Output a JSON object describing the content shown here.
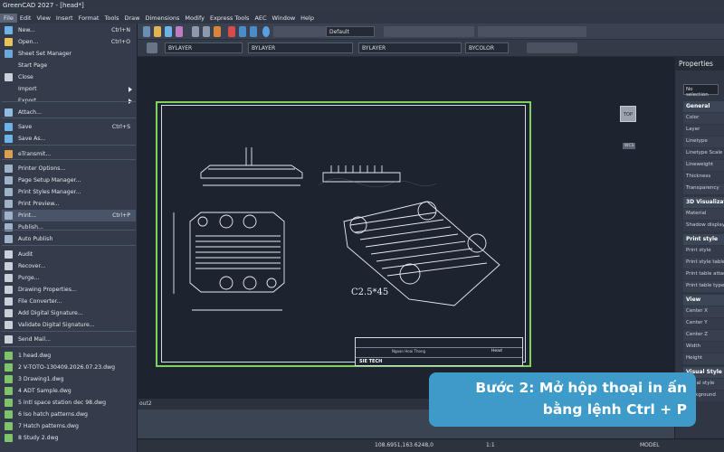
{
  "app": {
    "title": "GreenCAD 2027 - [head*]"
  },
  "menubar": [
    "File",
    "Edit",
    "View",
    "Insert",
    "Format",
    "Tools",
    "Draw",
    "Dimensions",
    "Modify",
    "Express Tools",
    "AEC",
    "Window",
    "Help"
  ],
  "toolbar": {
    "style_dropdown": "Default",
    "layer_dropdown": "BYLAYER",
    "linetype_dropdown": "BYLAYER",
    "lineweight_dropdown": "BYLAYER",
    "color_dropdown": "BYCOLOR"
  },
  "file_menu": [
    {
      "label": "New...",
      "shortcut": "Ctrl+N",
      "icon": "new-icon",
      "color": "#6db3e8"
    },
    {
      "label": "Open...",
      "shortcut": "Ctrl+O",
      "icon": "open-icon",
      "color": "#e9c35a"
    },
    {
      "label": "Sheet Set Manager",
      "shortcut": "",
      "icon": "sheet-set-icon",
      "color": "#6aa9d8"
    },
    {
      "label": "Start Page",
      "shortcut": "",
      "icon": "",
      "color": ""
    },
    {
      "label": "Close",
      "shortcut": "",
      "icon": "close-doc-icon",
      "color": "#c9d0da"
    },
    {
      "label": "Import",
      "shortcut": "",
      "icon": "",
      "color": "",
      "submenu": true
    },
    {
      "label": "Export",
      "shortcut": "",
      "icon": "",
      "color": "",
      "submenu": true
    },
    {
      "label": "Attach...",
      "shortcut": "",
      "icon": "attach-icon",
      "color": "#8fbce0"
    },
    {
      "label": "Save",
      "shortcut": "Ctrl+S",
      "icon": "save-icon",
      "color": "#6db3e8"
    },
    {
      "label": "Save As...",
      "shortcut": "",
      "icon": "save-as-icon",
      "color": "#6db3e8"
    },
    {
      "label": "eTransmit...",
      "shortcut": "",
      "icon": "etransmit-icon",
      "color": "#d9a04f"
    },
    {
      "label": "Printer Options...",
      "shortcut": "",
      "icon": "printer-options-icon",
      "color": "#9fb3c8"
    },
    {
      "label": "Page Setup Manager...",
      "shortcut": "",
      "icon": "page-setup-icon",
      "color": "#9fb3c8"
    },
    {
      "label": "Print Styles Manager...",
      "shortcut": "",
      "icon": "print-styles-icon",
      "color": "#9fb3c8"
    },
    {
      "label": "Print Preview...",
      "shortcut": "",
      "icon": "print-preview-icon",
      "color": "#9fb3c8"
    },
    {
      "label": "Print...",
      "shortcut": "Ctrl+P",
      "icon": "print-icon",
      "color": "#9fb3c8"
    },
    {
      "label": "Publish...",
      "shortcut": "",
      "icon": "publish-icon",
      "color": "#9fb3c8"
    },
    {
      "label": "Auto Publish",
      "shortcut": "",
      "icon": "auto-publish-icon",
      "color": "#9fb3c8"
    },
    {
      "label": "Audit",
      "shortcut": "",
      "icon": "audit-icon",
      "color": "#c9d0da"
    },
    {
      "label": "Recover...",
      "shortcut": "",
      "icon": "recover-icon",
      "color": "#c9d0da"
    },
    {
      "label": "Purge...",
      "shortcut": "",
      "icon": "purge-icon",
      "color": "#c9d0da"
    },
    {
      "label": "Drawing Properties...",
      "shortcut": "",
      "icon": "drawing-properties-icon",
      "color": "#c9d0da"
    },
    {
      "label": "File Converter...",
      "shortcut": "",
      "icon": "file-converter-icon",
      "color": "#c9d0da"
    },
    {
      "label": "Add Digital Signature...",
      "shortcut": "",
      "icon": "signature-icon",
      "color": "#c9d0da"
    },
    {
      "label": "Validate Digital Signature...",
      "shortcut": "",
      "icon": "validate-signature-icon",
      "color": "#c9d0da"
    },
    {
      "label": "Send Mail...",
      "shortcut": "",
      "icon": "mail-icon",
      "color": "#c9d0da"
    },
    {
      "label": "1 head.dwg",
      "shortcut": "",
      "icon": "dwg-file-icon",
      "color": "#7fc46a"
    },
    {
      "label": "2 V-TOTO-130409.2026.07.23.dwg",
      "shortcut": "",
      "icon": "dwg-file-icon",
      "color": "#7fc46a"
    },
    {
      "label": "3 Drawing1.dwg",
      "shortcut": "",
      "icon": "dwg-file-icon",
      "color": "#7fc46a"
    },
    {
      "label": "4 ADT Sample.dwg",
      "shortcut": "",
      "icon": "dwg-file-icon",
      "color": "#7fc46a"
    },
    {
      "label": "5 Intl space station dec 98.dwg",
      "shortcut": "",
      "icon": "dwg-file-icon",
      "color": "#7fc46a"
    },
    {
      "label": "6 Iso hatch patterns.dwg",
      "shortcut": "",
      "icon": "dwg-file-icon",
      "color": "#7fc46a"
    },
    {
      "label": "7 Hatch patterns.dwg",
      "shortcut": "",
      "icon": "dwg-file-icon",
      "color": "#7fc46a"
    },
    {
      "label": "8 Study 2.dwg",
      "shortcut": "",
      "icon": "dwg-file-icon",
      "color": "#7fc46a"
    }
  ],
  "properties": {
    "title": "Properties",
    "selection": "No selection",
    "items": [
      {
        "label": "General",
        "cat": true
      },
      {
        "label": "Color"
      },
      {
        "label": "Layer"
      },
      {
        "label": "Linetype"
      },
      {
        "label": "Linetype Scale"
      },
      {
        "label": "Lineweight"
      },
      {
        "label": "Thickness"
      },
      {
        "label": "Transparency"
      },
      {
        "label": "3D Visualization",
        "cat": true
      },
      {
        "label": "Material"
      },
      {
        "label": "Shadow display"
      },
      {
        "label": "Print style",
        "cat": true
      },
      {
        "label": "Print style"
      },
      {
        "label": "Print style table"
      },
      {
        "label": "Print table attached"
      },
      {
        "label": "Print table type"
      },
      {
        "label": "View",
        "cat": true
      },
      {
        "label": "Center X"
      },
      {
        "label": "Center Y"
      },
      {
        "label": "Center Z"
      },
      {
        "label": "Width"
      },
      {
        "label": "Height"
      },
      {
        "label": "Visual Style",
        "cat": true
      },
      {
        "label": "Visual style"
      },
      {
        "label": "Background"
      }
    ]
  },
  "canvas": {
    "viewcube": "TOP",
    "wcs": "WCS",
    "chamfer_note": "C2.5*45",
    "layout_tab": "out2",
    "title_block": {
      "brand": "SIE TECH",
      "name": "Head",
      "part": "Ngoan Hoai Thong"
    }
  },
  "statusbar": {
    "coords": "108.6951,163.6248,0",
    "scale": "1:1",
    "model": "MODEL"
  },
  "callout": {
    "line1": "Bước 2: Mở hộp thoại in ấn",
    "line2": "bằng lệnh Ctrl + P"
  }
}
